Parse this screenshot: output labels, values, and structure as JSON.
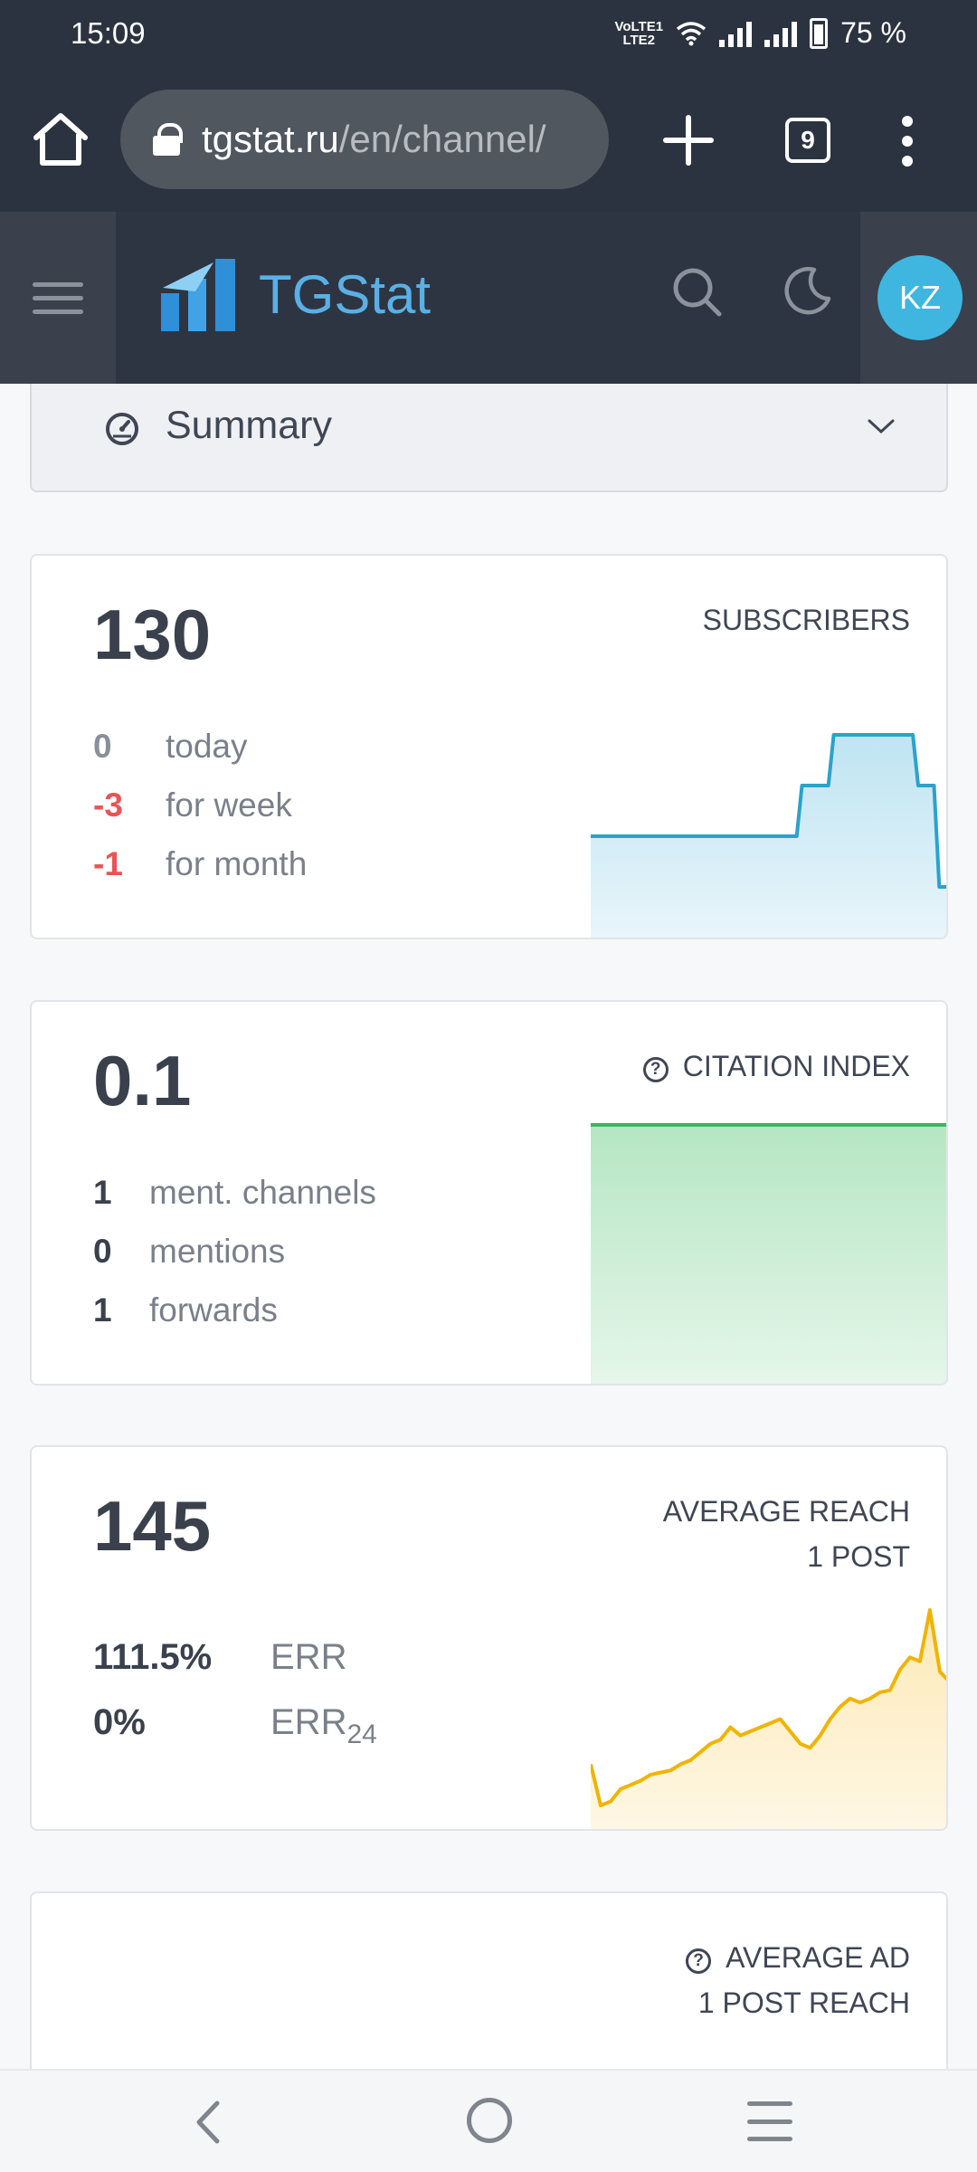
{
  "statusbar": {
    "time": "15:09",
    "network": "VoLTE1 LTE2",
    "battery": "75 %"
  },
  "browser": {
    "url_host": "tgstat.ru",
    "url_path": "/en/channel/",
    "tab_count": "9",
    "icons": [
      "home-icon",
      "lock-icon",
      "plus-icon",
      "tabs-icon",
      "more-vertical-icon"
    ]
  },
  "header": {
    "brand": "TGStat",
    "avatar_initials": "KZ",
    "colors": {
      "brand": "#5ab0e6",
      "avatar": "#3fb6e0",
      "header_bg": "#2e3542"
    }
  },
  "summary": {
    "label": "Summary"
  },
  "cards": {
    "subscribers": {
      "value": "130",
      "title": "SUBSCRIBERS",
      "stats": [
        {
          "value": "0",
          "label": "today"
        },
        {
          "value": "-3",
          "label": "for week"
        },
        {
          "value": "-1",
          "label": "for month"
        }
      ]
    },
    "citation": {
      "value": "0.1",
      "title": "CITATION INDEX",
      "stats": [
        {
          "value": "1",
          "label": "ment. channels"
        },
        {
          "value": "0",
          "label": "mentions"
        },
        {
          "value": "1",
          "label": "forwards"
        }
      ]
    },
    "reach": {
      "value": "145",
      "title_line1": "AVERAGE REACH",
      "title_line2": "1 POST",
      "stats": [
        {
          "value": "111.5%",
          "label": "ERR"
        },
        {
          "value": "0%",
          "label": "ERR",
          "sub": "24"
        }
      ]
    },
    "ad_reach": {
      "title_line1": "AVERAGE AD",
      "title_line2": "1 POST REACH"
    }
  },
  "sparklines": {
    "subscribers": {
      "color": "#2aa3cc",
      "fill": "#bfe4f2",
      "values": [
        128,
        128,
        128,
        128,
        128,
        128,
        128,
        128,
        128,
        128,
        128,
        128,
        128,
        128,
        128,
        128,
        128,
        128,
        128,
        128,
        128,
        128,
        128,
        128,
        128,
        128,
        128,
        128,
        128,
        128,
        128,
        128,
        128,
        128,
        128,
        128,
        128,
        128,
        128,
        128,
        131,
        131,
        131,
        131,
        131,
        131,
        134,
        134,
        134,
        134,
        134,
        134,
        134,
        134,
        134,
        134,
        134,
        134,
        134,
        134,
        134,
        134,
        131,
        131,
        131,
        131,
        125,
        125,
        125
      ]
    },
    "citation": {
      "color": "#3cb665",
      "fill": "#b6e6c3",
      "values": [
        1,
        1
      ]
    },
    "reach": {
      "color": "#f0b400",
      "fill": "#fde9b6",
      "values": [
        60,
        40,
        42,
        48,
        50,
        52,
        55,
        56,
        57,
        60,
        62,
        66,
        70,
        72,
        78,
        74,
        76,
        78,
        80,
        82,
        76,
        70,
        68,
        74,
        82,
        88,
        92,
        90,
        92,
        95,
        96,
        106,
        112,
        110,
        135,
        105,
        100
      ]
    }
  },
  "navbar": {
    "icons": [
      "back-icon",
      "home-circle-icon",
      "recents-icon"
    ]
  }
}
